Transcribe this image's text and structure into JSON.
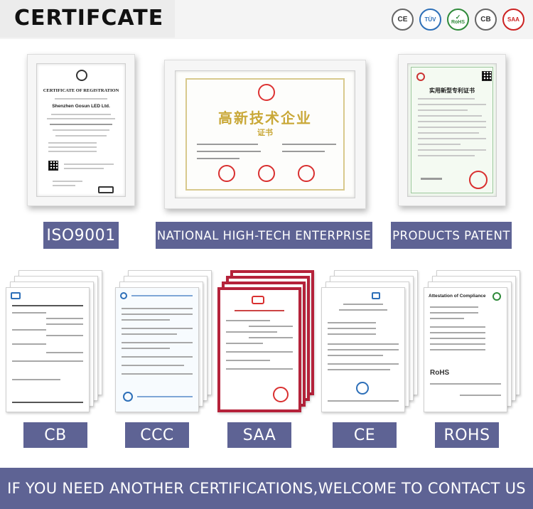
{
  "header": {
    "title": "CERTIFCATE",
    "badges": [
      {
        "name": "ce-icon",
        "text": "CE"
      },
      {
        "name": "tuv-icon",
        "text": "TÜV"
      },
      {
        "name": "rohs-icon",
        "text": "RoHS"
      },
      {
        "name": "cb-icon",
        "text": "CB"
      },
      {
        "name": "saa-icon",
        "text": "SAA"
      }
    ]
  },
  "top_certificates": [
    {
      "label": "ISO9001",
      "doc_title": "CERTIFICATE OF REGISTRATION",
      "company": "Shenzhen Gosun LED Ltd."
    },
    {
      "label": "NATIONAL HIGH-TECH ENTERPRISE",
      "doc_title": "高新技术企业",
      "doc_subtitle": "证书"
    },
    {
      "label": "PRODUCTS PATENT",
      "doc_title": "实用新型专利证书"
    }
  ],
  "bottom_certificates": [
    {
      "label": "CB"
    },
    {
      "label": "CCC"
    },
    {
      "label": "SAA"
    },
    {
      "label": "CE"
    },
    {
      "label": "ROHS",
      "doc_title": "Attestation of Compliance",
      "doc_mark": "RoHS"
    }
  ],
  "footer": {
    "text": "IF YOU NEED ANOTHER CERTIFICATIONS,WELCOME TO CONTACT US"
  }
}
